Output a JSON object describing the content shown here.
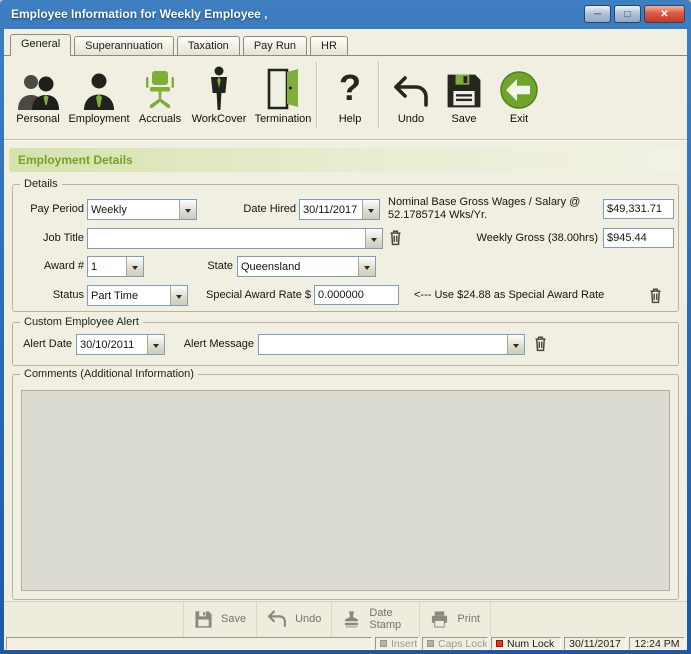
{
  "window": {
    "title": "Employee Information for Weekly Employee ,",
    "minimize_glyph": "─",
    "maximize_glyph": "□",
    "close_glyph": "✕"
  },
  "tabs": [
    {
      "label": "General"
    },
    {
      "label": "Superannuation"
    },
    {
      "label": "Taxation"
    },
    {
      "label": "Pay Run"
    },
    {
      "label": "HR"
    }
  ],
  "toolbar": {
    "help_glyph": "?",
    "items": [
      {
        "label": "Personal"
      },
      {
        "label": "Employment"
      },
      {
        "label": "Accruals"
      },
      {
        "label": "WorkCover"
      },
      {
        "label": "Termination"
      },
      {
        "label": "Help"
      },
      {
        "label": "Undo"
      },
      {
        "label": "Save"
      },
      {
        "label": "Exit"
      }
    ]
  },
  "section_title": "Employment Details",
  "details": {
    "legend": "Details",
    "pay_period_label": "Pay Period",
    "pay_period_value": "Weekly",
    "date_hired_label": "Date Hired",
    "date_hired_value": "30/11/2017",
    "nominal_label_line1": "Nominal Base Gross Wages / Salary @",
    "nominal_label_line2": "52.1785714 Wks/Yr.",
    "nominal_value": "$49,331.71",
    "job_title_label": "Job Title",
    "job_title_value": "",
    "weekly_gross_label": "Weekly Gross (38.00hrs)",
    "weekly_gross_value": "$945.44",
    "award_label": "Award #",
    "award_value": "1",
    "state_label": "State",
    "state_value": "Queensland",
    "status_label": "Status",
    "status_value": "Part Time",
    "special_rate_label": "Special Award Rate $",
    "special_rate_value": "0.000000",
    "special_rate_hint": "<--- Use $24.88 as Special Award Rate"
  },
  "alert": {
    "legend": "Custom Employee Alert",
    "alert_date_label": "Alert Date",
    "alert_date_value": "30/10/2011",
    "alert_message_label": "Alert Message",
    "alert_message_value": ""
  },
  "comments": {
    "legend": "Comments (Additional Information)"
  },
  "footer_buttons": [
    {
      "label": "Save"
    },
    {
      "label": "Undo"
    },
    {
      "label": "Date Stamp"
    },
    {
      "label": "Print"
    }
  ],
  "statusbar": {
    "insert": "Insert",
    "caps_lock": "Caps Lock",
    "num_lock": "Num Lock",
    "date": "30/11/2017",
    "time": "12:24 PM"
  }
}
